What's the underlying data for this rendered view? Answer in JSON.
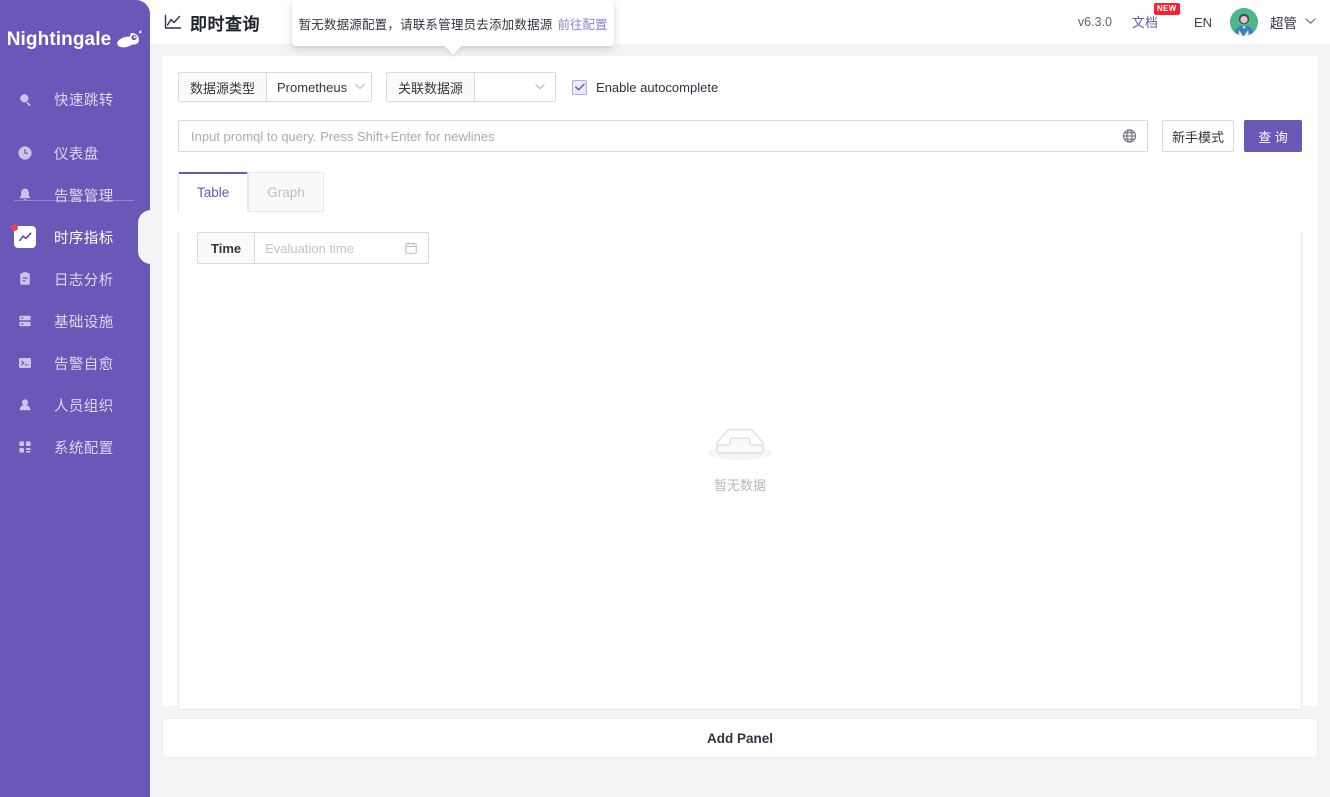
{
  "brand": {
    "name": "Nightingale",
    "logo_icon": "nightingale-bird-logo"
  },
  "sidebar": {
    "hamburger_icon": "hamburger-menu-icon",
    "quick_jump": {
      "label": "快速跳转",
      "icon": "search-icon"
    },
    "items": [
      {
        "label": "仪表盘",
        "icon": "dashboard-icon",
        "active": false
      },
      {
        "label": "告警管理",
        "icon": "alarm-bell-icon",
        "active": false
      },
      {
        "label": "时序指标",
        "icon": "line-chart-icon",
        "active": true
      },
      {
        "label": "日志分析",
        "icon": "document-log-icon",
        "active": false
      },
      {
        "label": "基础设施",
        "icon": "server-rack-icon",
        "active": false
      },
      {
        "label": "告警自愈",
        "icon": "terminal-icon",
        "active": false
      },
      {
        "label": "人员组织",
        "icon": "user-icon",
        "active": false
      },
      {
        "label": "系统配置",
        "icon": "grid-settings-icon",
        "active": false
      }
    ]
  },
  "header": {
    "title": "即时查询",
    "title_icon": "line-chart-icon",
    "version": "v6.3.0",
    "doc_label": "文档",
    "doc_badge": "NEW",
    "language": "EN",
    "avatar_icon": "user-avatar",
    "user_name": "超管",
    "caret_icon": "chevron-down-icon"
  },
  "tooltip": {
    "text": "暂无数据源配置，请联系管理员去添加数据源",
    "link": "前往配置"
  },
  "toolbar": {
    "datasource_type_label": "数据源类型",
    "datasource_type_value": "Prometheus",
    "related_datasource_label": "关联数据源",
    "related_datasource_value": "",
    "related_datasource_placeholder": "",
    "chevron_icon": "chevron-down-icon",
    "autocomplete_label": "Enable autocomplete",
    "autocomplete_checked": true,
    "check_icon": "check-icon"
  },
  "query": {
    "placeholder": "Input promql to query. Press Shift+Enter for newlines",
    "value": "",
    "globe_icon": "globe-icon",
    "beginner_mode_label": "新手模式",
    "submit_label": "查 询"
  },
  "tabs": [
    {
      "label": "Table",
      "active": true
    },
    {
      "label": "Graph",
      "active": false
    }
  ],
  "table": {
    "time_label": "Time",
    "time_placeholder": "Evaluation time",
    "calendar_icon": "calendar-icon",
    "empty_icon": "empty-box-icon",
    "empty_text": "暂无数据"
  },
  "footer": {
    "add_panel_label": "Add Panel"
  },
  "colors": {
    "sidebar_purple": "#6a57b8",
    "primary": "#6a57b8",
    "badge_red": "#f5222d",
    "dot_red": "#e8415e",
    "page_bg": "#f4f4f6",
    "link_purple": "#8f7fd4"
  }
}
